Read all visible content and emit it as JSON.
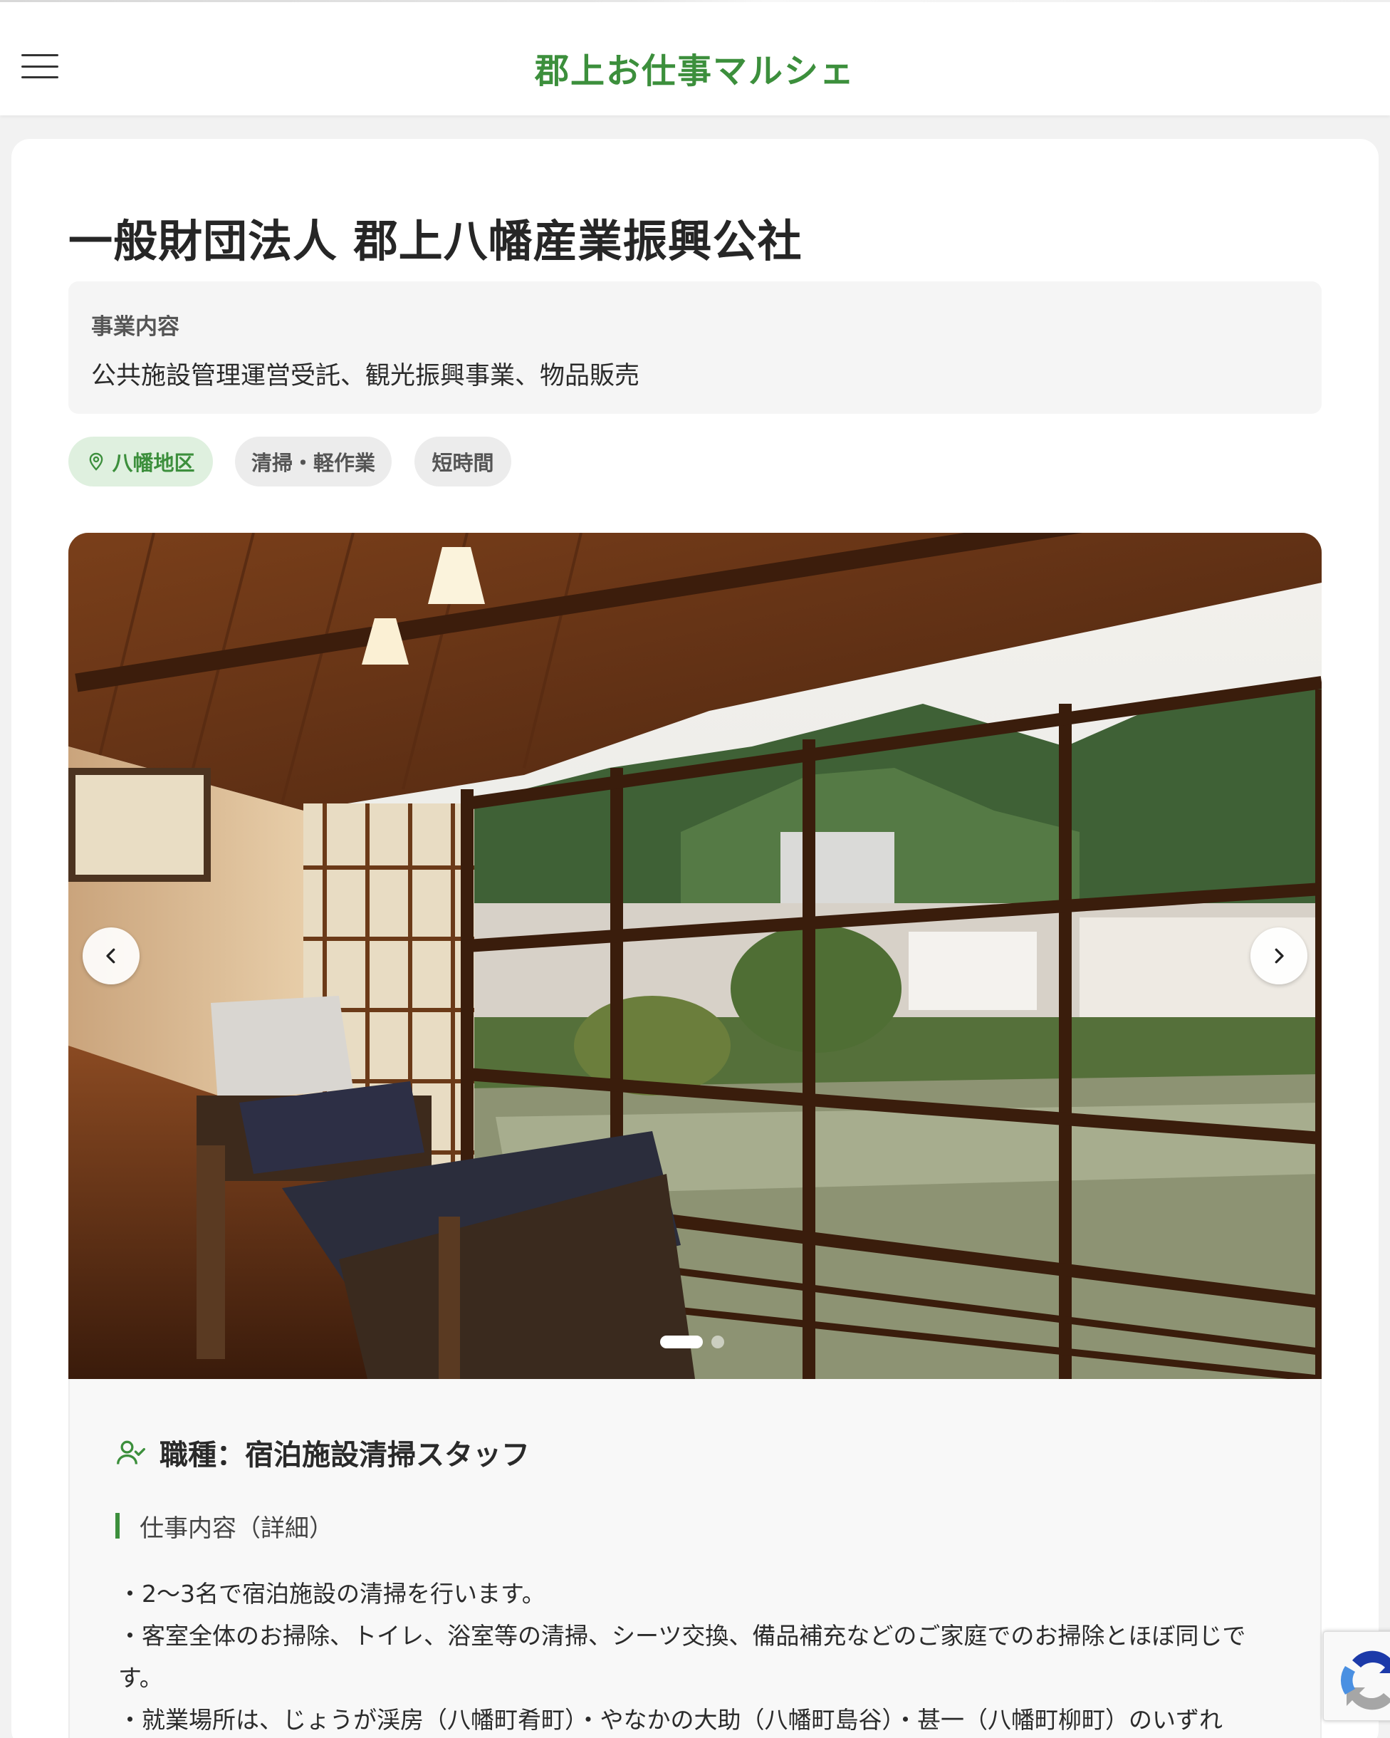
{
  "header": {
    "site_title": "郡上お仕事マルシェ",
    "menu_icon": "hamburger-menu-icon"
  },
  "company": {
    "name": "一般財団法人 郡上八幡産業振興公社",
    "business_label": "事業内容",
    "business_text": "公共施設管理運営受託、観光振興事業、物品販売"
  },
  "tags": {
    "area": "八幡地区",
    "category": "清掃・軽作業",
    "duration": "短時間"
  },
  "slider": {
    "prev_icon": "chevron-left-icon",
    "next_icon": "chevron-right-icon",
    "slide_count": 2,
    "active_slide": 1
  },
  "job": {
    "title": "職種：宿泊施設清掃スタッフ",
    "detail_label": "仕事内容（詳細）",
    "lines": [
      "・2〜3名で宿泊施設の清掃を行います。",
      "・客室全体のお掃除、トイレ、浴室等の清掃、シーツ交換、備品補充などのご家庭でのお掃除とほぼ同じで",
      "す。",
      "・就業場所は、じょうが渓房（八幡町肴町）・やなかの大助（八幡町島谷）・甚一（八幡町柳町）のいずれ"
    ]
  },
  "colors": {
    "brand_green": "#3c8f3c",
    "tag_green_bg": "#dff0df",
    "tag_gray_bg": "#ececec"
  }
}
